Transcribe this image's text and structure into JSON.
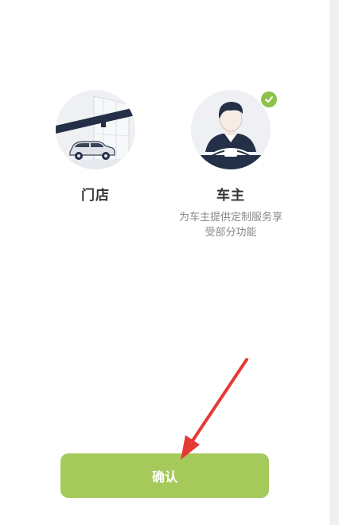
{
  "options": [
    {
      "title": "门店",
      "description": "",
      "selected": false,
      "icon": "storefront-car-icon"
    },
    {
      "title": "车主",
      "description": "为车主提供定制服务享受部分功能",
      "selected": true,
      "icon": "driver-icon"
    }
  ],
  "confirm_label": "确认",
  "colors": {
    "accent_green": "#a6c95c",
    "check_green": "#8dc24b",
    "annotation_red": "#e53935",
    "title_text": "#333333",
    "desc_text": "#888888"
  }
}
